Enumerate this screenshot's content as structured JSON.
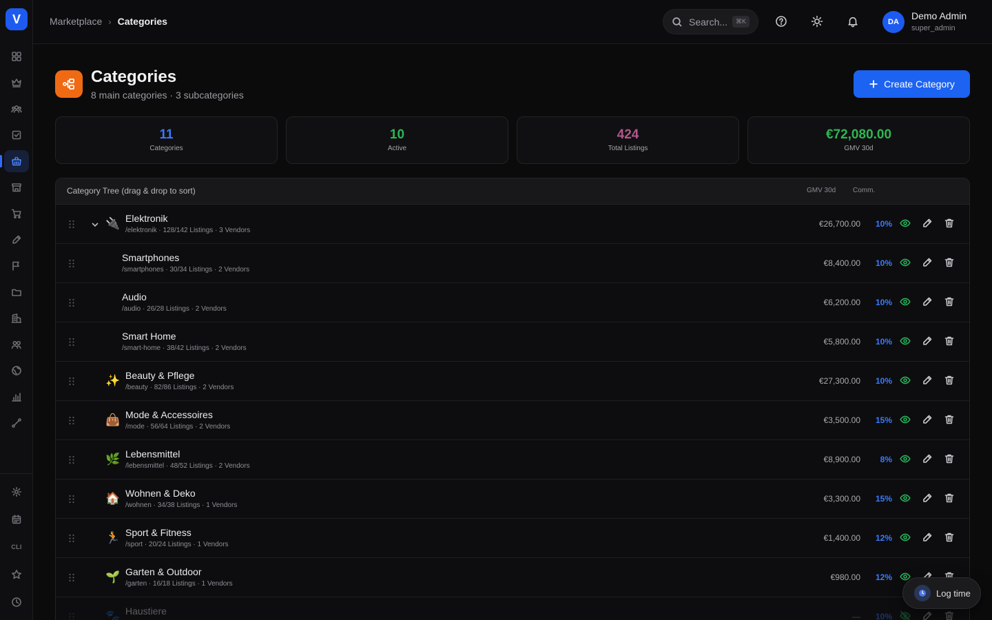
{
  "app": {
    "logo_letter": "V"
  },
  "breadcrumb": {
    "parent": "Marketplace",
    "separator": "›",
    "current": "Categories"
  },
  "search": {
    "placeholder": "Search...",
    "shortcut": "⌘K"
  },
  "user": {
    "initials": "DA",
    "name": "Demo Admin",
    "role": "super_admin"
  },
  "page": {
    "title": "Categories",
    "subtitle": "8 main categories · 3 subcategories",
    "create_label": "Create Category"
  },
  "stats": [
    {
      "value": "11",
      "label": "Categories",
      "color": "#3b78ff"
    },
    {
      "value": "10",
      "label": "Active",
      "color": "#2fb653"
    },
    {
      "value": "424",
      "label": "Total Listings",
      "color": "#b0578c"
    },
    {
      "value": "€72,080.00",
      "label": "GMV 30d",
      "color": "#2fb653"
    }
  ],
  "table": {
    "title": "Category Tree (drag & drop to sort)",
    "col_gmv": "GMV 30d",
    "col_comm": "Comm.",
    "rows": [
      {
        "name": "Elektronik",
        "meta": "/elektronik · 128/142 Listings · 3 Vendors",
        "gmv": "€26,700.00",
        "comm": "10%",
        "icon": "🔌",
        "expanded": true,
        "level": 0
      },
      {
        "name": "Smartphones",
        "meta": "/smartphones · 30/34 Listings · 2 Vendors",
        "gmv": "€8,400.00",
        "comm": "10%",
        "icon": "",
        "level": 1
      },
      {
        "name": "Audio",
        "meta": "/audio · 26/28 Listings · 2 Vendors",
        "gmv": "€6,200.00",
        "comm": "10%",
        "icon": "",
        "level": 1
      },
      {
        "name": "Smart Home",
        "meta": "/smart-home · 38/42 Listings · 2 Vendors",
        "gmv": "€5,800.00",
        "comm": "10%",
        "icon": "",
        "level": 1
      },
      {
        "name": "Beauty & Pflege",
        "meta": "/beauty · 82/86 Listings · 2 Vendors",
        "gmv": "€27,300.00",
        "comm": "10%",
        "icon": "✨",
        "level": 0
      },
      {
        "name": "Mode & Accessoires",
        "meta": "/mode · 56/64 Listings · 2 Vendors",
        "gmv": "€3,500.00",
        "comm": "15%",
        "icon": "👜",
        "level": 0
      },
      {
        "name": "Lebensmittel",
        "meta": "/lebensmittel · 48/52 Listings · 2 Vendors",
        "gmv": "€8,900.00",
        "comm": "8%",
        "icon": "🌿",
        "level": 0
      },
      {
        "name": "Wohnen & Deko",
        "meta": "/wohnen · 34/38 Listings · 1 Vendors",
        "gmv": "€3,300.00",
        "comm": "15%",
        "icon": "🏠",
        "level": 0
      },
      {
        "name": "Sport & Fitness",
        "meta": "/sport · 20/24 Listings · 1 Vendors",
        "gmv": "€1,400.00",
        "comm": "12%",
        "icon": "🏃",
        "level": 0
      },
      {
        "name": "Garten & Outdoor",
        "meta": "/garten · 16/18 Listings · 1 Vendors",
        "gmv": "€980.00",
        "comm": "12%",
        "icon": "🌱",
        "level": 0
      },
      {
        "name": "Haustiere",
        "meta": "",
        "gmv": "—",
        "comm": "10%",
        "icon": "🐾",
        "level": 0,
        "inactive": true
      }
    ]
  },
  "log_time": {
    "label": "Log time"
  },
  "sidebar": {
    "icons": [
      "dashboard-icon",
      "crown-icon",
      "users-icon",
      "checklist-icon",
      "marketplace-icon",
      "store-icon",
      "cart-icon",
      "pen-icon",
      "flag-icon",
      "folder-icon",
      "building-icon",
      "team-icon",
      "globe-icon",
      "chart-icon",
      "route-icon"
    ],
    "bottom_icons": [
      "settings-icon",
      "calendar-icon",
      "cli-icon",
      "star-icon",
      "clock-icon"
    ],
    "cli_label": "CLI"
  }
}
